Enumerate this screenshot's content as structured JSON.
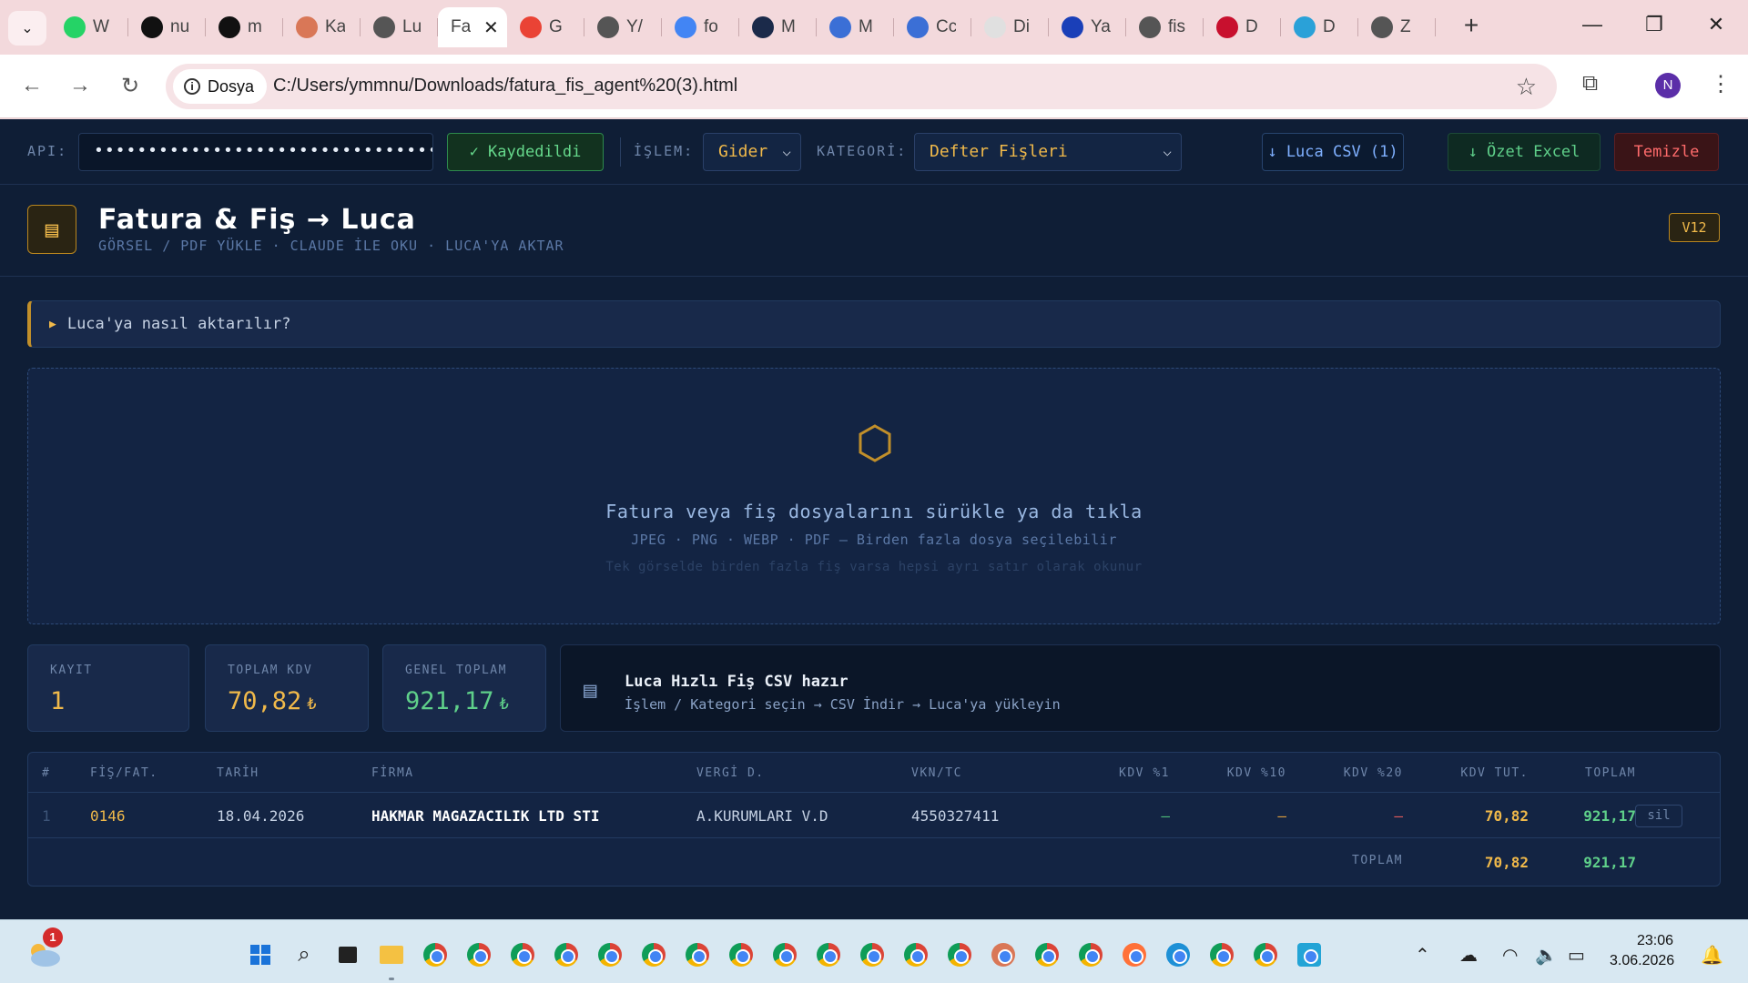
{
  "browser": {
    "tabs": [
      {
        "title": "W",
        "icon": "whatsapp-icon",
        "color": "#25d366"
      },
      {
        "title": "nu",
        "icon": "github-icon",
        "color": "#111111"
      },
      {
        "title": "m",
        "icon": "app-icon",
        "color": "#111111"
      },
      {
        "title": "Ka",
        "icon": "claude-icon",
        "color": "#d97757"
      },
      {
        "title": "Lu",
        "icon": "globe-icon",
        "color": "#555555"
      },
      {
        "title": "Fa",
        "icon": "",
        "color": "",
        "active": true
      },
      {
        "title": "G",
        "icon": "gmail-icon",
        "color": "#ea4335"
      },
      {
        "title": "Y/",
        "icon": "puzzle-icon",
        "color": "#555555"
      },
      {
        "title": "fo",
        "icon": "google-icon",
        "color": "#4285f4"
      },
      {
        "title": "M",
        "icon": "app-icon",
        "color": "#1b2a4a"
      },
      {
        "title": "M",
        "icon": "app-icon",
        "color": "#3b6fd6"
      },
      {
        "title": "Cc",
        "icon": "app-icon",
        "color": "#3b6fd6"
      },
      {
        "title": "Di",
        "icon": "app-icon",
        "color": "#e0e0e0"
      },
      {
        "title": "Ya",
        "icon": "app-icon",
        "color": "#1a3fb8"
      },
      {
        "title": "fis",
        "icon": "globe-icon",
        "color": "#555555"
      },
      {
        "title": "D",
        "icon": "app-icon",
        "color": "#c8102e"
      },
      {
        "title": "D",
        "icon": "bing-icon",
        "color": "#2aa1d8"
      },
      {
        "title": "Z",
        "icon": "globe-icon",
        "color": "#555555"
      }
    ],
    "site_chip": "Dosya",
    "url": "C:/Users/ymmnu/Downloads/fatura_fis_agent%20(3).html",
    "profile_initial": "N"
  },
  "topbar": {
    "api_label": "API:",
    "api_value": "••••••••••••••••••••••••••••••••",
    "saved_label": "✓ Kaydedildi",
    "islem_label": "İŞLEM:",
    "islem_value": "Gider",
    "kategori_label": "KATEGORİ:",
    "kategori_value": "Defter Fişleri",
    "csv_button": "↓ Luca CSV (1)",
    "excel_button": "↓ Özet Excel",
    "clear_button": "Temizle"
  },
  "header": {
    "title": "Fatura & Fiş → Luca",
    "subtitle": "GÖRSEL / PDF YÜKLE · CLAUDE İLE OKU · LUCA'YA AKTAR",
    "version": "V12"
  },
  "howto": {
    "label": "Luca'ya nasıl aktarılır?"
  },
  "dropzone": {
    "title": "Fatura veya fiş dosyalarını sürükle ya da tıkla",
    "formats": "JPEG · PNG · WEBP · PDF — Birden fazla dosya seçilebilir",
    "note": "Tek görselde birden fazla fiş varsa hepsi ayrı satır olarak okunur"
  },
  "stats": {
    "records_label": "KAYIT",
    "records_value": "1",
    "vat_label": "TOPLAM KDV",
    "vat_value": "70,82",
    "total_label": "GENEL TOPLAM",
    "total_value": "921,17",
    "currency": "₺"
  },
  "info": {
    "title": "Luca Hızlı Fiş CSV hazır",
    "subtitle": "İşlem / Kategori seçin → CSV İndir → Luca'ya yükleyin"
  },
  "table": {
    "columns": [
      "#",
      "FİŞ/FAT.",
      "TARİH",
      "FİRMA",
      "VERGİ D.",
      "VKN/TC",
      "KDV %1",
      "KDV %10",
      "KDV %20",
      "KDV TUT.",
      "TOPLAM"
    ],
    "rows": [
      {
        "index": "1",
        "doc_no": "0146",
        "date": "18.04.2026",
        "company": "HAKMAR MAGAZACILIK LTD STI",
        "tax_office": "A.KURUMLARI V.D",
        "vkn": "4550327411",
        "kdv1": "—",
        "kdv10": "—",
        "kdv20": "—",
        "kdv_total": "70,82",
        "total": "921,17",
        "delete_label": "sil"
      }
    ],
    "footer_label": "TOPLAM",
    "footer_kdv": "70,82",
    "footer_total": "921,17"
  },
  "taskbar": {
    "weather_badge": "1",
    "time": "23:06",
    "date": "3.06.2026"
  }
}
